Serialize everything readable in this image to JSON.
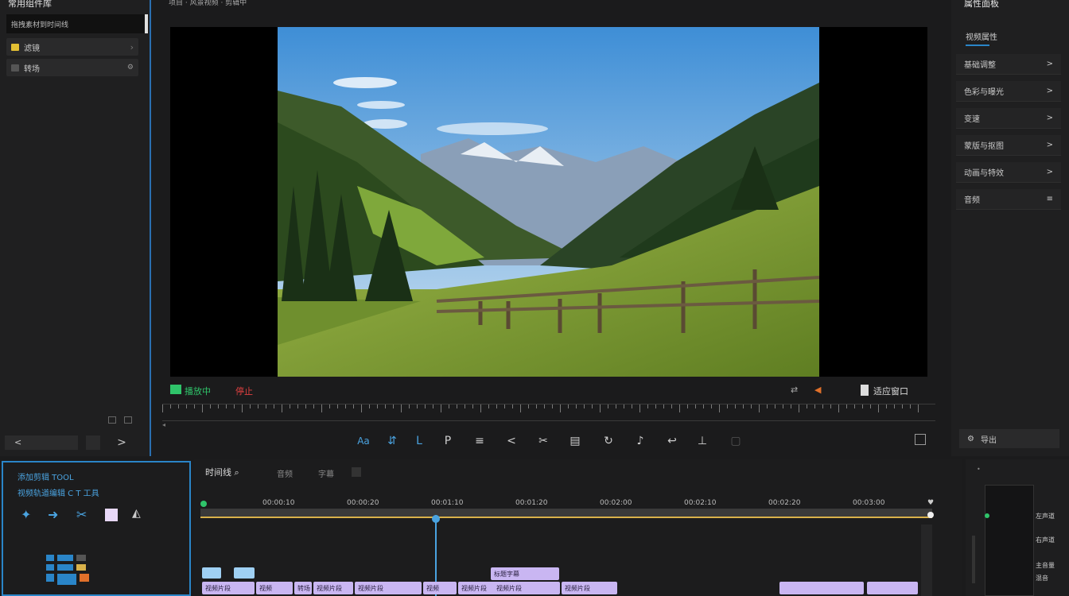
{
  "left_panel": {
    "title": "常用组件库",
    "search_value": "拖拽素材到时间线",
    "items": [
      {
        "label": "滤镜",
        "icon": "folder-icon"
      },
      {
        "label": "转场",
        "icon": "folder-icon"
      }
    ],
    "back_label": "<",
    "next_label": ">"
  },
  "header": {
    "subtitle": "项目 · 风景视频 · 剪辑中"
  },
  "preview": {
    "scene_label": "mountain-meadow-landscape",
    "badge_green": "播放中",
    "badge_red": "停止",
    "fit_label": "适应窗口",
    "toolbar": [
      "Aa",
      "⇵",
      "L",
      "P",
      "≡",
      "<",
      "✂",
      "▤",
      "↻",
      "♪",
      "↩",
      "⊥",
      "▢"
    ]
  },
  "right_panel": {
    "title": "属性面板",
    "tab_active": "视频属性",
    "items": [
      {
        "label": "基础调整",
        "arrow": ">"
      },
      {
        "label": "色彩与曝光",
        "arrow": ">"
      },
      {
        "label": "变速",
        "arrow": ">"
      },
      {
        "label": "蒙版与抠图",
        "arrow": ">"
      },
      {
        "label": "动画与特效",
        "arrow": ">"
      },
      {
        "label": "音频",
        "arrow": "≡"
      }
    ],
    "footer_button": "导出"
  },
  "bottom_left": {
    "line1": "添加剪辑 TOOL",
    "line2": "视频轨道编辑 C T 工具",
    "tools": [
      "pin-icon",
      "arrow-right-icon",
      "scissors-icon",
      "square-icon",
      "speaker-icon"
    ]
  },
  "timeline": {
    "tabs": [
      "时间线 ⌕",
      "音频",
      "字幕"
    ],
    "timecodes": [
      "00:00:10",
      "00:00:20",
      "00:01:10",
      "00:01:20",
      "00:02:00",
      "00:02:10",
      "00:02:20",
      "00:03:00"
    ],
    "clips_top": [
      "标题字幕"
    ],
    "clips_row": [
      "视频片段",
      "视频",
      "转场",
      "视频片段",
      "视频片段",
      "视频",
      "视频片段",
      "视频片段",
      "视频片段"
    ]
  },
  "audio_meter": {
    "labels": [
      "左声道",
      "右声道",
      "主音量",
      "混音"
    ]
  },
  "colors": {
    "accent": "#2a85c8",
    "playhead": "#4aa3e0",
    "clip": "#c9b6f2",
    "gold": "#d8b14a"
  }
}
